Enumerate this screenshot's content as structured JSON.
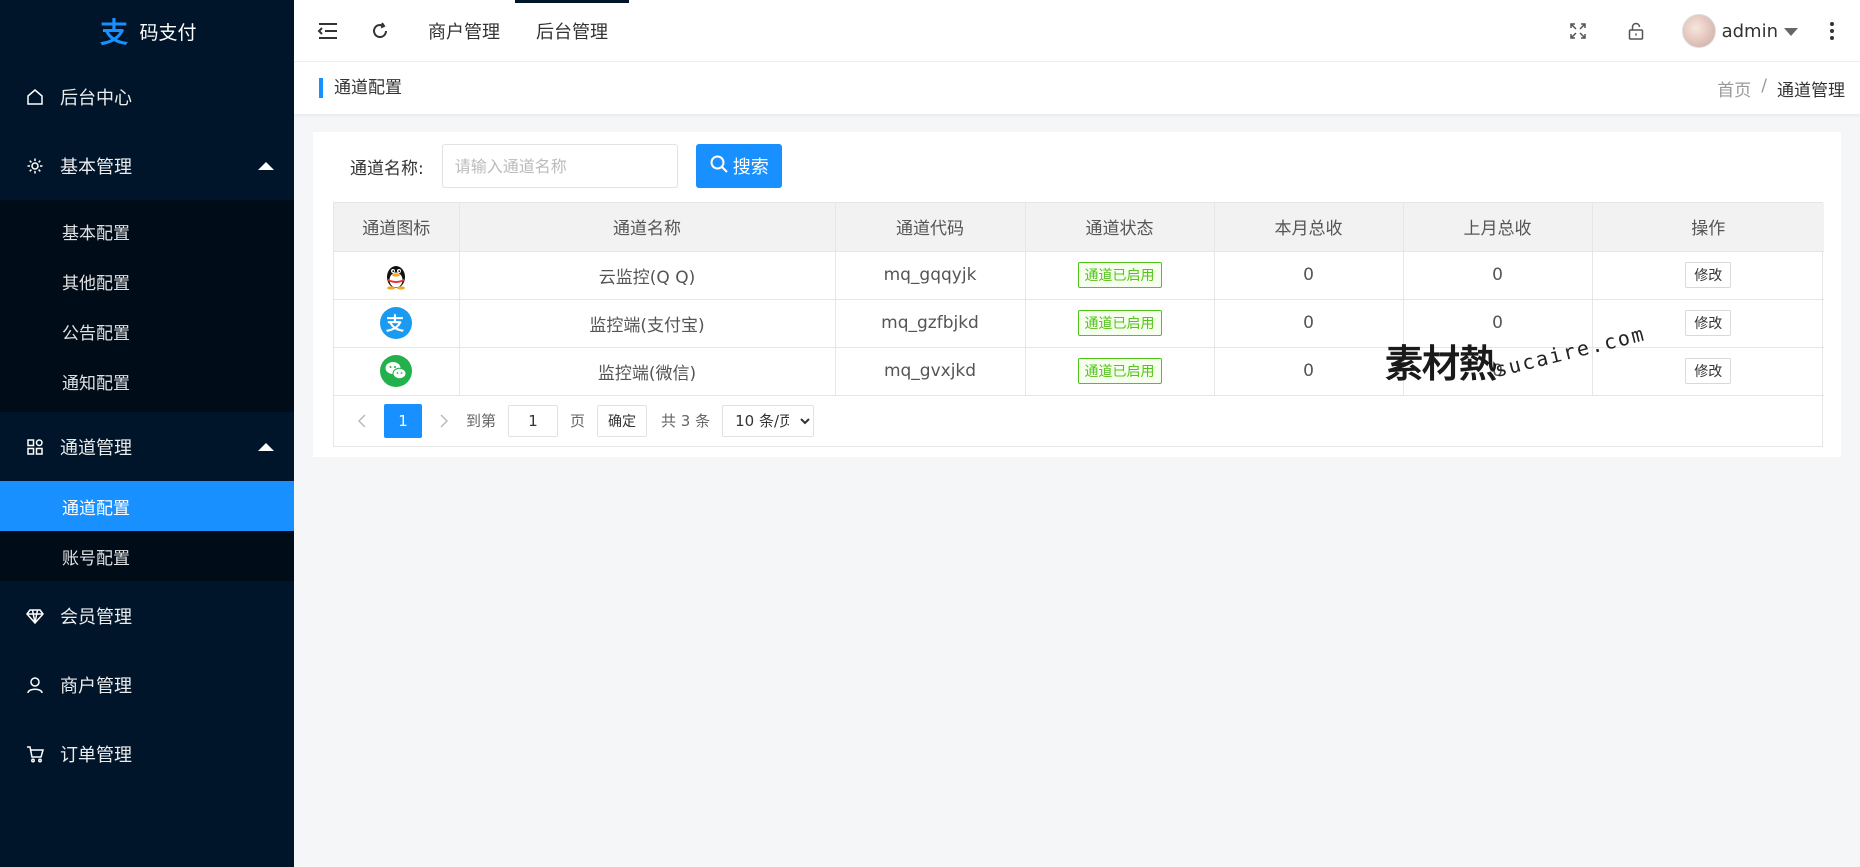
{
  "app": {
    "title": "码支付"
  },
  "sidebar": {
    "items": [
      {
        "label": "后台中心",
        "icon": "home-icon"
      },
      {
        "label": "基本管理",
        "icon": "gear-icon",
        "expanded": true,
        "children": [
          "基本配置",
          "其他配置",
          "公告配置",
          "通知配置"
        ]
      },
      {
        "label": "通道管理",
        "icon": "apps-icon",
        "expanded": true,
        "children": [
          "通道配置",
          "账号配置"
        ],
        "active_child": "通道配置"
      },
      {
        "label": "会员管理",
        "icon": "diamond-icon"
      },
      {
        "label": "商户管理",
        "icon": "user-icon"
      },
      {
        "label": "订单管理",
        "icon": "cart-icon"
      }
    ]
  },
  "header": {
    "tabs": [
      "商户管理",
      "后台管理"
    ],
    "active_tab": "后台管理",
    "user": "admin"
  },
  "crumbbar": {
    "title": "通道配置",
    "breadcrumb": [
      "首页",
      "通道管理"
    ],
    "separator": "/"
  },
  "search": {
    "label": "通道名称:",
    "placeholder": "请输入通道名称",
    "button": "搜索"
  },
  "table": {
    "columns": [
      "通道图标",
      "通道名称",
      "通道代码",
      "通道状态",
      "本月总收",
      "上月总收",
      "操作"
    ],
    "rows": [
      {
        "icon": "qq-icon",
        "name": "云监控(Q Q)",
        "code": "mq_gqqyjk",
        "status": "通道已启用",
        "this_month": "0",
        "last_month": "0",
        "action": "修改"
      },
      {
        "icon": "alipay-icon",
        "name": "监控端(支付宝)",
        "code": "mq_gzfbjkd",
        "status": "通道已启用",
        "this_month": "0",
        "last_month": "0",
        "action": "修改"
      },
      {
        "icon": "wechat-icon",
        "name": "监控端(微信)",
        "code": "mq_gvxjkd",
        "status": "通道已启用",
        "this_month": "0",
        "last_month": "0",
        "action": "修改"
      }
    ]
  },
  "pager": {
    "current": "1",
    "goto_prefix": "到第",
    "goto_value": "1",
    "goto_suffix": "页",
    "confirm": "确定",
    "total": "共 3 条",
    "page_size": "10 条/页"
  },
  "watermark": {
    "cn": "素材熱",
    "en": "sucaire.com"
  },
  "colors": {
    "sidebar_bg": "#001529",
    "accent": "#1890ff",
    "success": "#52c41a"
  }
}
